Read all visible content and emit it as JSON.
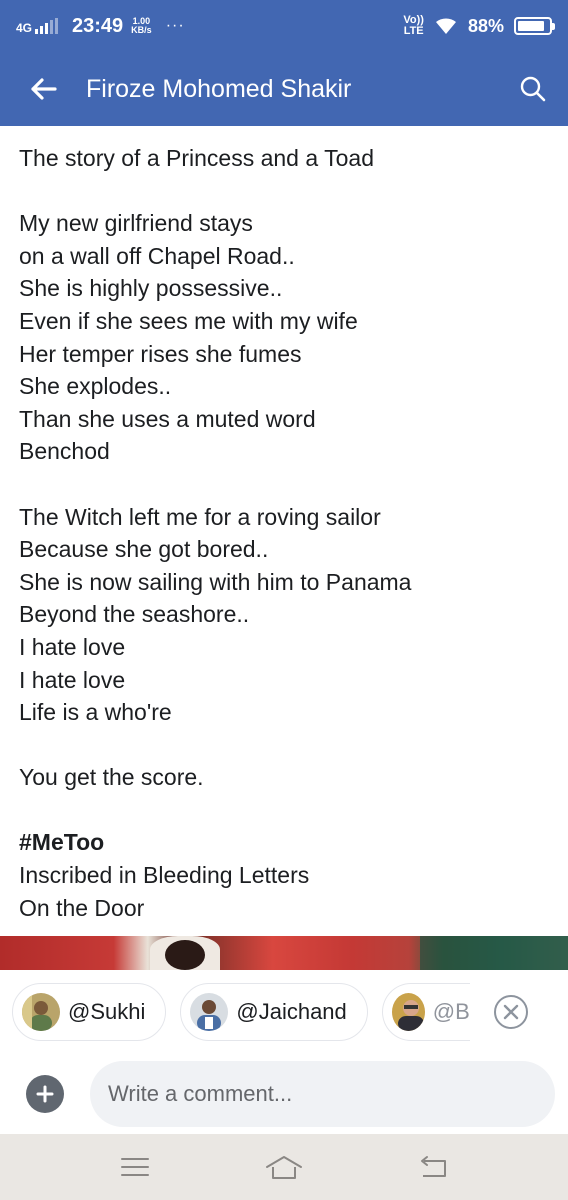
{
  "status_bar": {
    "network": "4G",
    "time": "23:49",
    "speed_value": "1.00",
    "speed_unit": "KB/s",
    "more": "···",
    "volte_top": "Vo))",
    "volte_bottom": "LTE",
    "battery_percent": "88%",
    "battery_level": 0.88
  },
  "app_bar": {
    "title": "Firoze Mohomed Shakir",
    "back_icon": "arrow-left-icon",
    "search_icon": "search-icon",
    "color": "#4267b2"
  },
  "post": {
    "lines": [
      "The story of a Princess and a Toad",
      "",
      "My new girlfriend stays",
      "on a wall off Chapel Road..",
      "She is highly possessive..",
      "Even if she sees me with my wife",
      "Her temper rises she fumes",
      "She explodes..",
      "Than she uses a muted word",
      "Benchod",
      "",
      "The Witch left me for a roving sailor",
      "Because she got bored..",
      "She is now sailing with him to Panama",
      "Beyond the seashore..",
      "I hate love",
      "I hate love",
      "Life is a who're",
      "",
      "You get the score.",
      "",
      "#MeToo",
      "Inscribed in Bleeding Letters",
      "On the Door"
    ]
  },
  "mentions": {
    "chips": [
      {
        "label": "@Sukhi"
      },
      {
        "label": "@Jaichand"
      },
      {
        "label": "@B"
      }
    ],
    "close_icon": "close-circle-icon"
  },
  "comment": {
    "placeholder": "Write a comment...",
    "add_icon": "plus-circle-icon"
  },
  "nav_bar": {
    "menu_icon": "menu-icon",
    "home_icon": "home-icon",
    "back_icon": "back-return-icon"
  }
}
